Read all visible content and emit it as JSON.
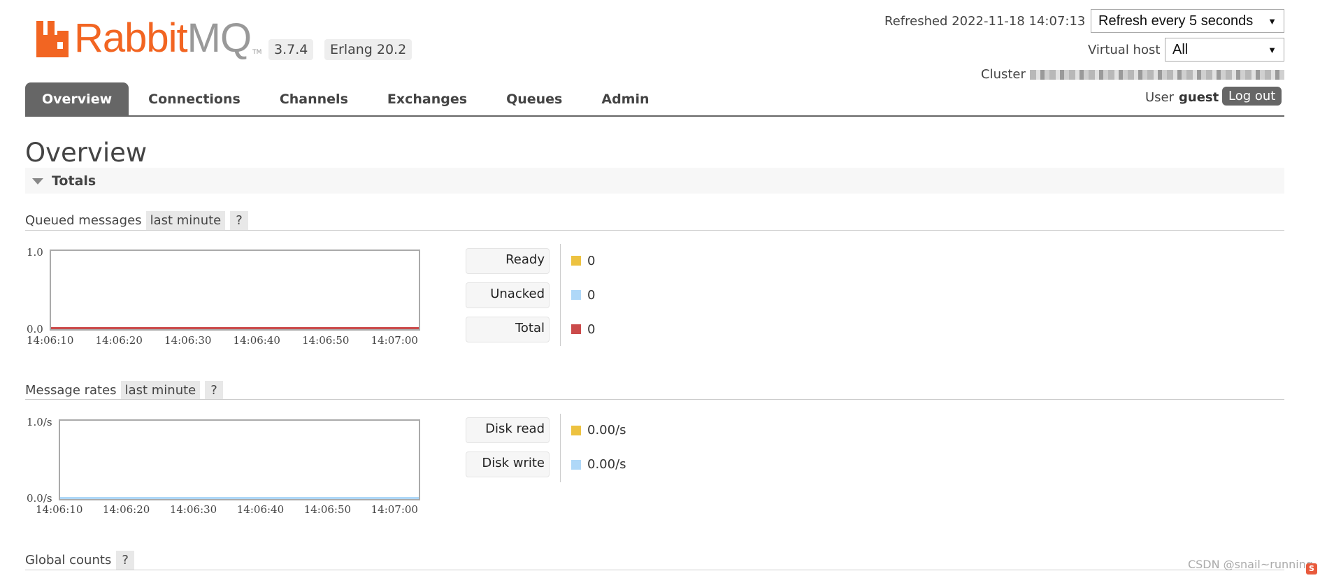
{
  "header": {
    "logo_text_a": "Rabbit",
    "logo_text_b": "MQ",
    "logo_tm": "TM",
    "version": "3.7.4",
    "erlang": "Erlang 20.2",
    "refreshed_label": "Refreshed 2022-11-18 14:07:13",
    "refresh_select": "Refresh every 5 seconds",
    "vhost_label": "Virtual host",
    "vhost_select": "All",
    "cluster_label": "Cluster",
    "user_label": "User",
    "user_name": "guest",
    "logout_label": "Log out"
  },
  "tabs": [
    {
      "label": "Overview",
      "active": true
    },
    {
      "label": "Connections"
    },
    {
      "label": "Channels"
    },
    {
      "label": "Exchanges"
    },
    {
      "label": "Queues"
    },
    {
      "label": "Admin"
    }
  ],
  "page_title": "Overview",
  "totals_title": "Totals",
  "queued": {
    "title": "Queued messages",
    "range": "last minute",
    "help": "?",
    "y_top": "1.0",
    "y_bottom": "0.0",
    "x_ticks": [
      "14:06:10",
      "14:06:20",
      "14:06:30",
      "14:06:40",
      "14:06:50",
      "14:07:00"
    ],
    "legend": [
      {
        "label": "Ready",
        "value": "0",
        "color": "#edc240"
      },
      {
        "label": "Unacked",
        "value": "0",
        "color": "#afd8f8"
      },
      {
        "label": "Total",
        "value": "0",
        "color": "#cb4b4b"
      }
    ]
  },
  "rates": {
    "title": "Message rates",
    "range": "last minute",
    "help": "?",
    "y_top": "1.0/s",
    "y_bottom": "0.0/s",
    "x_ticks": [
      "14:06:10",
      "14:06:20",
      "14:06:30",
      "14:06:40",
      "14:06:50",
      "14:07:00"
    ],
    "legend": [
      {
        "label": "Disk read",
        "value": "0.00/s",
        "color": "#edc240"
      },
      {
        "label": "Disk write",
        "value": "0.00/s",
        "color": "#afd8f8"
      }
    ]
  },
  "global": {
    "title": "Global counts",
    "help": "?"
  },
  "watermark": "CSDN @snail~running",
  "brand_color": "#f26522"
}
